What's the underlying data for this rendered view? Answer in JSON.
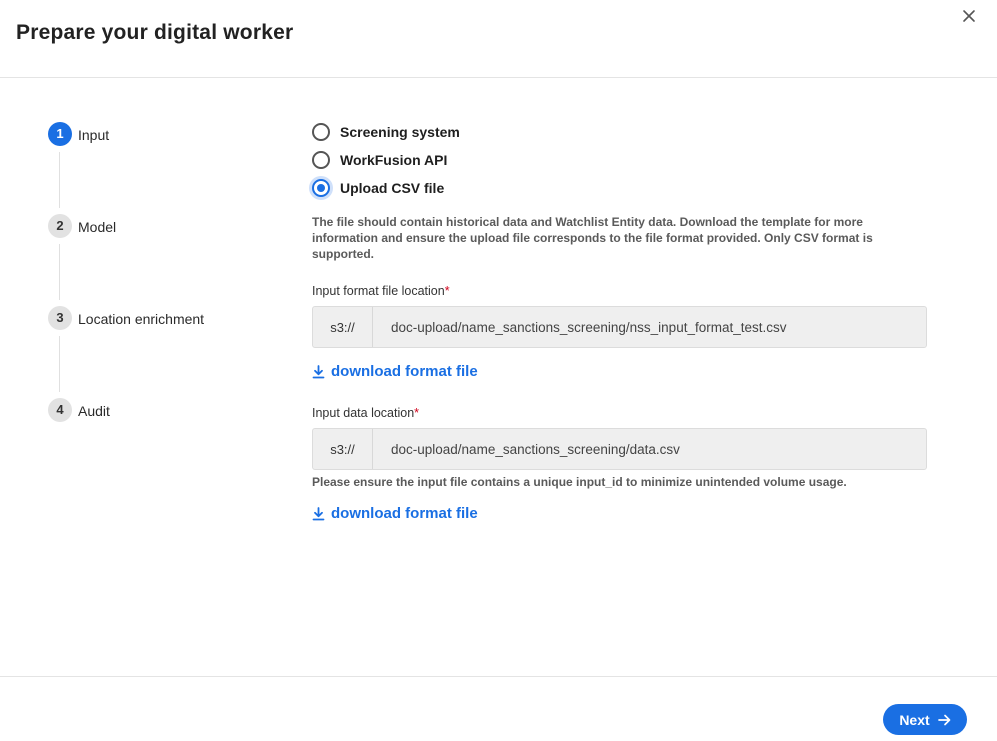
{
  "dialog": {
    "title": "Prepare your digital worker",
    "close_icon": "close-icon"
  },
  "steps": [
    {
      "number": "1",
      "label": "Input",
      "active": true
    },
    {
      "number": "2",
      "label": "Model",
      "active": false
    },
    {
      "number": "3",
      "label": "Location enrichment",
      "active": false
    },
    {
      "number": "4",
      "label": "Audit",
      "active": false
    }
  ],
  "input_source": {
    "options": [
      {
        "label": "Screening system",
        "checked": false
      },
      {
        "label": "WorkFusion API",
        "checked": false
      },
      {
        "label": "Upload CSV file",
        "checked": true
      }
    ],
    "description": "The file should contain historical data and Watchlist Entity data. Download the template for more information and ensure the upload file corresponds to the file format provided. Only CSV format is supported."
  },
  "format_file": {
    "label": "Input format file location",
    "required_mark": "*",
    "prefix": "s3://",
    "value": "doc-upload/name_sanctions_screening/nss_input_format_test.csv",
    "download_label": "download format file",
    "download_icon": "download-icon"
  },
  "data_file": {
    "label": "Input data location",
    "required_mark": "*",
    "prefix": "s3://",
    "value": "doc-upload/name_sanctions_screening/data.csv",
    "note": "Please ensure the input file contains a unique input_id to minimize unintended volume usage.",
    "download_label": "download format file",
    "download_icon": "download-icon"
  },
  "footer": {
    "next_label": "Next",
    "next_icon": "arrow-right-icon"
  },
  "colors": {
    "accent": "#1a6fe3",
    "required": "#d0021b"
  }
}
